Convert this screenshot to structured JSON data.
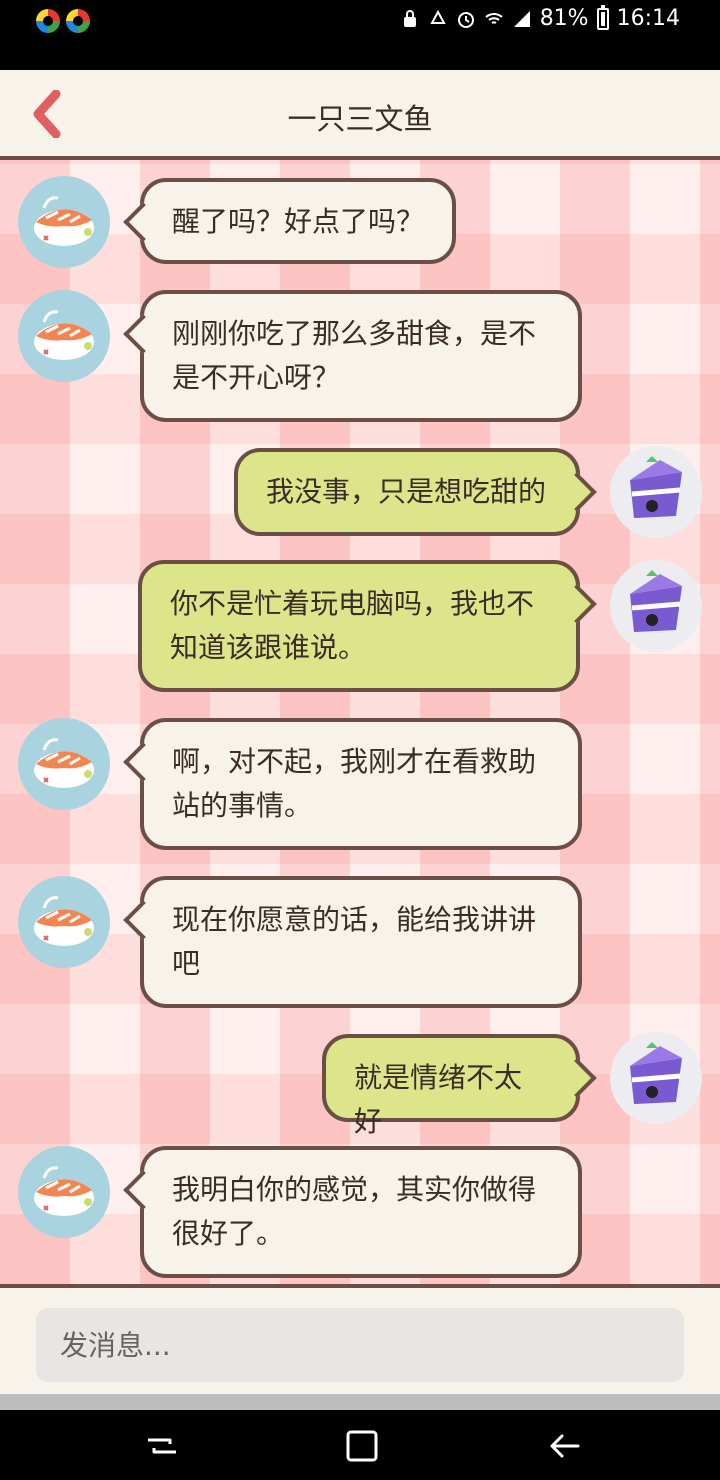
{
  "status_bar": {
    "battery": "81%",
    "time": "16:14"
  },
  "header": {
    "title": "一只三文鱼"
  },
  "messages": [
    {
      "sender": "bot",
      "text": "醒了吗？好点了吗？"
    },
    {
      "sender": "bot",
      "text": "刚刚你吃了那么多甜食，是不是不开心呀？"
    },
    {
      "sender": "me",
      "text": "我没事，只是想吃甜的"
    },
    {
      "sender": "me",
      "text": "你不是忙着玩电脑吗，我也不知道该跟谁说。"
    },
    {
      "sender": "bot",
      "text": "啊，对不起，我刚才在看救助站的事情。"
    },
    {
      "sender": "bot",
      "text": "现在你愿意的话，能给我讲讲吧"
    },
    {
      "sender": "me",
      "text": "就是情绪不太好"
    },
    {
      "sender": "bot",
      "text": "我明白你的感觉，其实你做得很好了。"
    }
  ],
  "input": {
    "placeholder": "发消息..."
  },
  "colors": {
    "header_bg": "#f7f2ea",
    "border": "#6b4f47",
    "bot_bubble": "#f7f2ea",
    "me_bubble": "#dde58a",
    "back_arrow": "#e06060",
    "chat_bg": "#fde4e1"
  },
  "icons": {
    "back": "back-arrow-icon",
    "bot_avatar": "salmon-sushi-avatar",
    "me_avatar": "cake-avatar",
    "nav_recent": "recent-apps-icon",
    "nav_home": "home-icon",
    "nav_back": "nav-back-icon"
  }
}
